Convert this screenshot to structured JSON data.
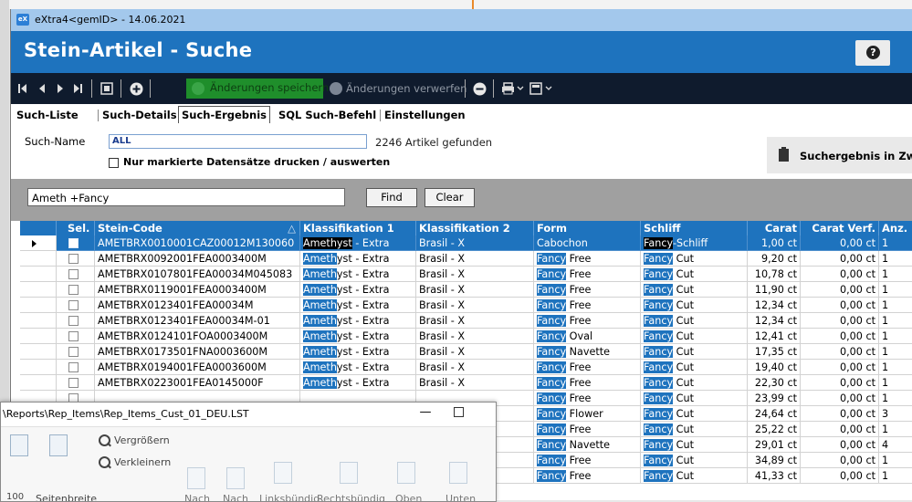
{
  "window": {
    "title": "eXtra4<gemID>  -  14.06.2021",
    "app_icon_text": "eX"
  },
  "header": {
    "title": "Stein-Artikel  -  Suche",
    "help_icon": "?"
  },
  "toolbar": {
    "save_label": "Änderungen speichern",
    "discard_label": "Änderungen verwerfen",
    "icons": [
      "first-record-icon",
      "prev-record-icon",
      "next-record-icon",
      "last-record-icon",
      "list-view-icon",
      "add-icon",
      "save-icon",
      "discard-icon",
      "delete-icon",
      "print-icon",
      "export-icon"
    ]
  },
  "tabs": [
    {
      "label": "Such-Liste",
      "active": false
    },
    {
      "label": "Such-Details",
      "active": false
    },
    {
      "label": "Such-Ergebnis",
      "active": true
    },
    {
      "label": "SQL Such-Befehl",
      "active": false
    },
    {
      "label": "Einstellungen",
      "active": false
    }
  ],
  "search": {
    "name_label": "Such-Name",
    "name_value": "ALL",
    "found_text": "2246 Artikel gefunden",
    "print_checkbox_label": "Nur markierte Datensätze drucken / auswerten",
    "suchergebnis_button": "Suchergebnis in Zw"
  },
  "filter": {
    "value": "Ameth +Fancy",
    "find_label": "Find",
    "clear_label": "Clear"
  },
  "grid": {
    "columns": [
      "",
      "Sel.",
      "Stein-Code",
      "Klassifikation 1",
      "Klassifikation 2",
      "Form",
      "Schliff",
      "Carat",
      "Carat Verf.",
      "Anz."
    ],
    "sort_indicator": "△",
    "rows": [
      {
        "code": "AMETBRX0010001CAZ00012M130060",
        "k1_hl": "Amethyst",
        "k1_rest": " - Extra",
        "k2": "Brasil - X",
        "form_hl": "",
        "form_rest": "Cabochon",
        "schliff_hl": "Fancy",
        "schliff_rest": "-Schliff",
        "carat": "1,00 ct",
        "carat_verf": "0,00 ct",
        "anz": "1",
        "selected": true
      },
      {
        "code": "AMETBRX0092001FEA0003400M",
        "k1_hl": "Ameth",
        "k1_rest": "yst - Extra",
        "k2": "Brasil - X",
        "form_hl": "Fancy",
        "form_rest": " Free",
        "schliff_hl": "Fancy",
        "schliff_rest": " Cut",
        "carat": "9,20 ct",
        "carat_verf": "0,00 ct",
        "anz": "1"
      },
      {
        "code": "AMETBRX0107801FEA00034M045083",
        "k1_hl": "Ameth",
        "k1_rest": "yst - Extra",
        "k2": "Brasil - X",
        "form_hl": "Fancy",
        "form_rest": " Free",
        "schliff_hl": "Fancy",
        "schliff_rest": " Cut",
        "carat": "10,78 ct",
        "carat_verf": "0,00 ct",
        "anz": "1"
      },
      {
        "code": "AMETBRX0119001FEA0003400M",
        "k1_hl": "Ameth",
        "k1_rest": "yst - Extra",
        "k2": "Brasil - X",
        "form_hl": "Fancy",
        "form_rest": " Free",
        "schliff_hl": "Fancy",
        "schliff_rest": " Cut",
        "carat": "11,90 ct",
        "carat_verf": "0,00 ct",
        "anz": "1"
      },
      {
        "code": "AMETBRX0123401FEA00034M",
        "k1_hl": "Ameth",
        "k1_rest": "yst - Extra",
        "k2": "Brasil - X",
        "form_hl": "Fancy",
        "form_rest": " Free",
        "schliff_hl": "Fancy",
        "schliff_rest": " Cut",
        "carat": "12,34 ct",
        "carat_verf": "0,00 ct",
        "anz": "1"
      },
      {
        "code": "AMETBRX0123401FEA00034M-01",
        "k1_hl": "Ameth",
        "k1_rest": "yst - Extra",
        "k2": "Brasil - X",
        "form_hl": "Fancy",
        "form_rest": " Free",
        "schliff_hl": "Fancy",
        "schliff_rest": " Cut",
        "carat": "12,34 ct",
        "carat_verf": "0,00 ct",
        "anz": "1"
      },
      {
        "code": "AMETBRX0124101FOA0003400M",
        "k1_hl": "Ameth",
        "k1_rest": "yst - Extra",
        "k2": "Brasil - X",
        "form_hl": "Fancy",
        "form_rest": " Oval",
        "schliff_hl": "Fancy",
        "schliff_rest": " Cut",
        "carat": "12,41 ct",
        "carat_verf": "0,00 ct",
        "anz": "1"
      },
      {
        "code": "AMETBRX0173501FNA0003600M",
        "k1_hl": "Ameth",
        "k1_rest": "yst - Extra",
        "k2": "Brasil - X",
        "form_hl": "Fancy",
        "form_rest": " Navette",
        "schliff_hl": "Fancy",
        "schliff_rest": " Cut",
        "carat": "17,35 ct",
        "carat_verf": "0,00 ct",
        "anz": "1"
      },
      {
        "code": "AMETBRX0194001FEA0003600M",
        "k1_hl": "Ameth",
        "k1_rest": "yst - Extra",
        "k2": "Brasil - X",
        "form_hl": "Fancy",
        "form_rest": " Free",
        "schliff_hl": "Fancy",
        "schliff_rest": " Cut",
        "carat": "19,40 ct",
        "carat_verf": "0,00 ct",
        "anz": "1"
      },
      {
        "code": "AMETBRX0223001FEA0145000F",
        "k1_hl": "Ameth",
        "k1_rest": "yst - Extra",
        "k2": "Brasil - X",
        "form_hl": "Fancy",
        "form_rest": " Free",
        "schliff_hl": "Fancy",
        "schliff_rest": " Cut",
        "carat": "22,30 ct",
        "carat_verf": "0,00 ct",
        "anz": "1"
      },
      {
        "code": "",
        "k1_hl": "",
        "k1_rest": "",
        "k2": "",
        "form_hl": "Fancy",
        "form_rest": " Free",
        "schliff_hl": "Fancy",
        "schliff_rest": " Cut",
        "carat": "23,99 ct",
        "carat_verf": "0,00 ct",
        "anz": "1"
      },
      {
        "code": "",
        "k1_hl": "",
        "k1_rest": "",
        "k2": "",
        "form_hl": "Fancy",
        "form_rest": " Flower",
        "schliff_hl": "Fancy",
        "schliff_rest": " Cut",
        "carat": "24,64 ct",
        "carat_verf": "0,00 ct",
        "anz": "3"
      },
      {
        "code": "",
        "k1_hl": "",
        "k1_rest": "",
        "k2": "",
        "form_hl": "Fancy",
        "form_rest": " Free",
        "schliff_hl": "Fancy",
        "schliff_rest": " Cut",
        "carat": "25,22 ct",
        "carat_verf": "0,00 ct",
        "anz": "1"
      },
      {
        "code": "",
        "k1_hl": "",
        "k1_rest": "",
        "k2": "",
        "form_hl": "Fancy",
        "form_rest": " Navette",
        "schliff_hl": "Fancy",
        "schliff_rest": " Cut",
        "carat": "29,01 ct",
        "carat_verf": "0,00 ct",
        "anz": "4"
      },
      {
        "code": "",
        "k1_hl": "",
        "k1_rest": "",
        "k2": "",
        "form_hl": "Fancy",
        "form_rest": " Free",
        "schliff_hl": "Fancy",
        "schliff_rest": " Cut",
        "carat": "34,89 ct",
        "carat_verf": "0,00 ct",
        "anz": "1"
      },
      {
        "code": "",
        "k1_hl": "",
        "k1_rest": "",
        "k2": "",
        "form_hl": "Fancy",
        "form_rest": " Free",
        "schliff_hl": "Fancy",
        "schliff_rest": " Cut",
        "carat": "41,33 ct",
        "carat_verf": "0,00 ct",
        "anz": "1"
      }
    ]
  },
  "preview": {
    "title": "\\Reports\\Rep_Items\\Rep_Items_Cust_01_DEU.LST",
    "minimize": "—",
    "zoom_in": "Vergrößern",
    "zoom_out": "Verkleinern",
    "zoom_value": "100",
    "page_width": "Seitenbreite",
    "nach1": "Nach",
    "nach2": "Nach",
    "left_align": "Linksbündig",
    "right_align": "Rechtsbündig",
    "top": "Oben",
    "bottom": "Unten"
  },
  "colors": {
    "header_blue": "#1e73be",
    "toolbar_dark": "#0f1b2d",
    "save_green": "#1f8e2b",
    "filter_gray": "#a0a0a0"
  }
}
